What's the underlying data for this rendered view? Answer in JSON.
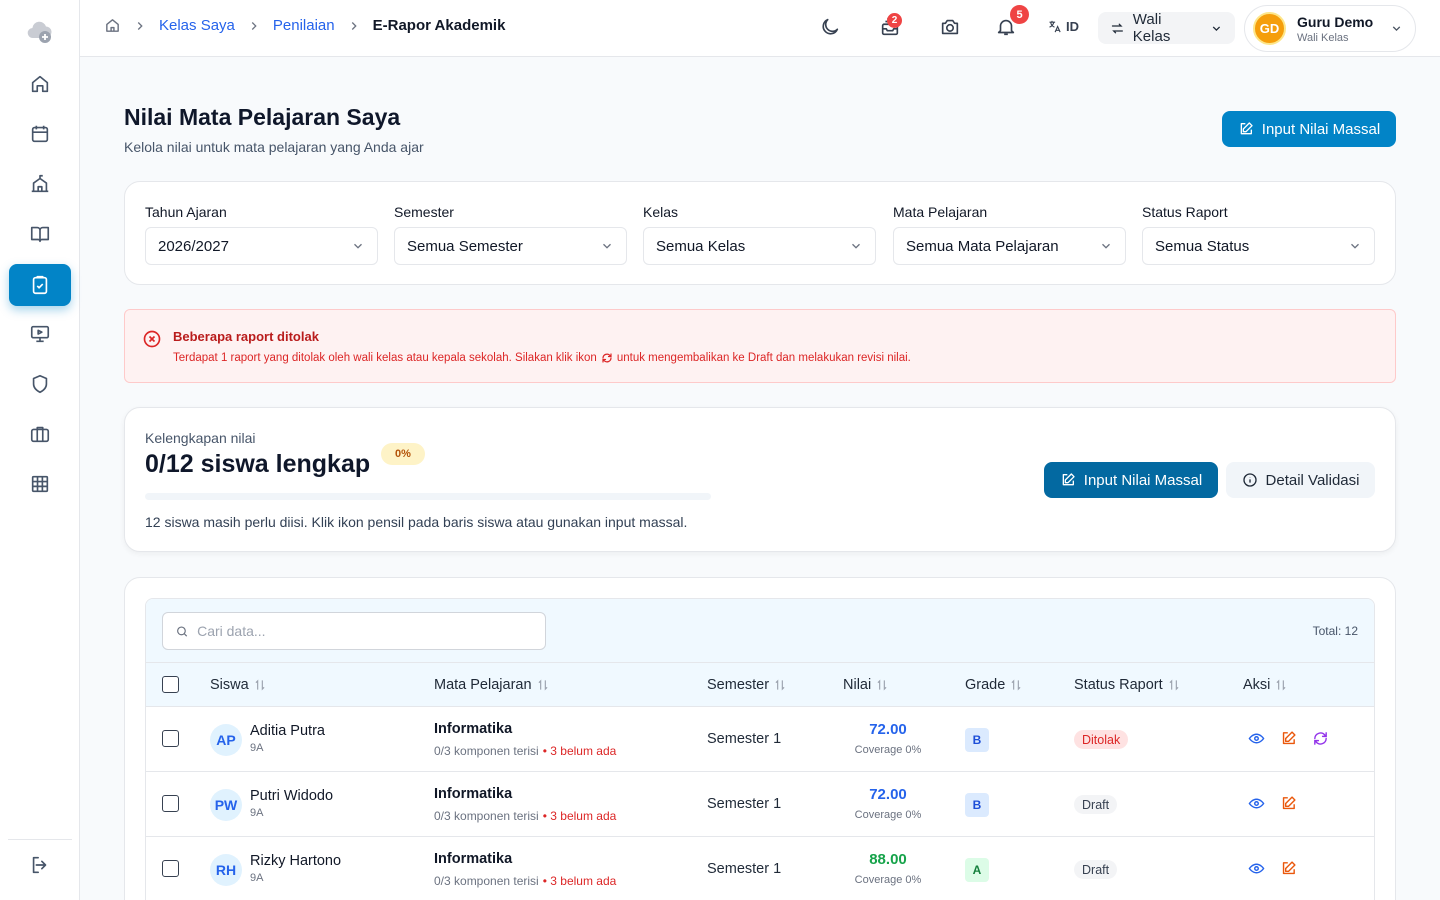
{
  "colors": {
    "accent": "#0284c7",
    "danger": "#dc2626",
    "warning": "#b45309",
    "success": "#16a34a",
    "link": "#2563eb"
  },
  "sidebar": {
    "logo_icon": "cloud-camera-icon",
    "items": [
      {
        "icon": "home-icon",
        "active": false
      },
      {
        "icon": "calendar-icon",
        "active": false
      },
      {
        "icon": "school-building-icon",
        "active": false
      },
      {
        "icon": "open-book-icon",
        "active": false
      },
      {
        "icon": "clipboard-check-icon",
        "active": true
      },
      {
        "icon": "presentation-screen-icon",
        "active": false
      },
      {
        "icon": "shield-icon",
        "active": false
      },
      {
        "icon": "briefcase-icon",
        "active": false
      },
      {
        "icon": "grid-icon",
        "active": false
      }
    ],
    "logout_icon": "logout-icon"
  },
  "topbar": {
    "breadcrumb": [
      "Kelas Saya",
      "Penilaian",
      "E-Rapor Akademik"
    ],
    "messages_badge": "2",
    "notifications_badge": "5",
    "language": "ID",
    "role_label": "Wali Kelas",
    "user": {
      "initials": "GD",
      "name": "Guru Demo",
      "role": "Wali Kelas"
    }
  },
  "page": {
    "title": "Nilai Mata Pelajaran Saya",
    "subtitle": "Kelola nilai untuk mata pelajaran yang Anda ajar",
    "bulk_input_label": "Input Nilai Massal"
  },
  "filters": [
    {
      "label": "Tahun Ajaran",
      "value": "2026/2027"
    },
    {
      "label": "Semester",
      "value": "Semua Semester"
    },
    {
      "label": "Kelas",
      "value": "Semua Kelas"
    },
    {
      "label": "Mata Pelajaran",
      "value": "Semua Mata Pelajaran"
    },
    {
      "label": "Status Raport",
      "value": "Semua Status"
    }
  ],
  "alert": {
    "title": "Beberapa raport ditolak",
    "text_before": "Terdapat 1 raport yang ditolak oleh wali kelas atau kepala sekolah. Silakan klik ikon",
    "text_after": "untuk mengembalikan ke Draft dan melakukan revisi nilai."
  },
  "completeness": {
    "label": "Kelengkapan nilai",
    "value": "0/12 siswa lengkap",
    "percent_label": "0%",
    "percent": 0,
    "note": "12 siswa masih perlu diisi. Klik ikon pensil pada baris siswa atau gunakan input massal.",
    "bulk_input_label": "Input Nilai Massal",
    "detail_label": "Detail Validasi"
  },
  "table": {
    "search_placeholder": "Cari data...",
    "total": "Total: 12",
    "columns": [
      "Siswa",
      "Mata Pelajaran",
      "Semester",
      "Nilai",
      "Grade",
      "Status Raport",
      "Aksi"
    ],
    "rows": [
      {
        "initials": "AP",
        "name": "Aditia Putra",
        "class": "9A",
        "subject": "Informatika",
        "components": "0/3 komponen terisi",
        "missing": "• 3 belum ada",
        "semester": "Semester 1",
        "score": "72.00",
        "score_color": "#2563eb",
        "coverage": "Coverage 0%",
        "grade": "B",
        "status": "Ditolak",
        "rejected": true
      },
      {
        "initials": "PW",
        "name": "Putri Widodo",
        "class": "9A",
        "subject": "Informatika",
        "components": "0/3 komponen terisi",
        "missing": "• 3 belum ada",
        "semester": "Semester 1",
        "score": "72.00",
        "score_color": "#2563eb",
        "coverage": "Coverage 0%",
        "grade": "B",
        "status": "Draft",
        "rejected": false
      },
      {
        "initials": "RH",
        "name": "Rizky Hartono",
        "class": "9A",
        "subject": "Informatika",
        "components": "0/3 komponen terisi",
        "missing": "• 3 belum ada",
        "semester": "Semester 1",
        "score": "88.00",
        "score_color": "#16a34a",
        "coverage": "Coverage 0%",
        "grade": "A",
        "status": "Draft",
        "rejected": false
      }
    ]
  }
}
